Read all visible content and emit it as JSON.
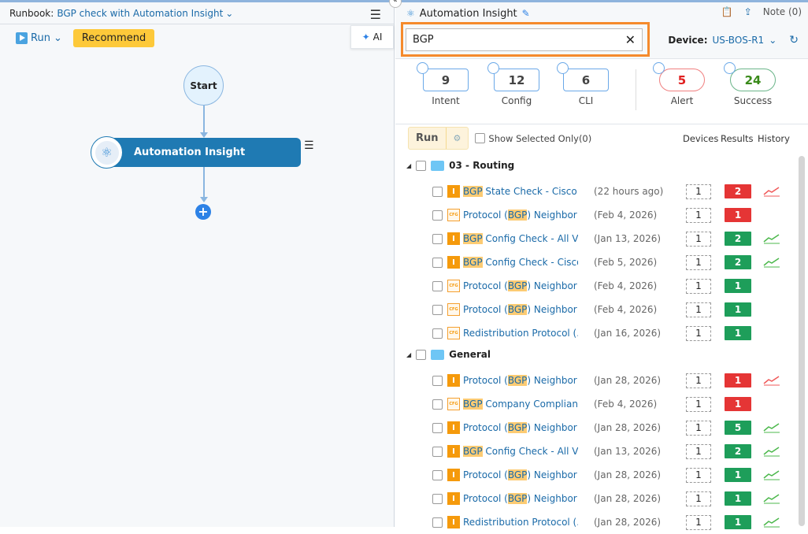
{
  "left": {
    "runbook_label": "Runbook:",
    "runbook_name": "BGP check with Automation Insight",
    "run_label": "Run",
    "recommend_label": "Recommend",
    "ai_label": "AI",
    "start_label": "Start",
    "node_label": "Automation Insight"
  },
  "right": {
    "title": "Automation Insight",
    "note_label": "Note (0)",
    "search_value": "BGP",
    "device_label": "Device:",
    "device_value": "US-BOS-R1",
    "stats": [
      {
        "value": "9",
        "label": "Intent"
      },
      {
        "value": "12",
        "label": "Config"
      },
      {
        "value": "6",
        "label": "CLI"
      },
      {
        "value": "5",
        "label": "Alert"
      },
      {
        "value": "24",
        "label": "Success"
      }
    ],
    "run_label": "Run",
    "show_selected_label": "Show Selected Only(0)",
    "columns": {
      "devices": "Devices",
      "results": "Results",
      "history": "History"
    },
    "colors": {
      "red": "#e53535",
      "green": "#1e9e5a"
    },
    "folders": [
      {
        "name": "03 - Routing",
        "rows": [
          {
            "type": "I",
            "pre": "",
            "hl": "BGP",
            "post": " State Check - Cisco I...",
            "date": "(22 hours ago)",
            "devices": "1",
            "result": "2",
            "status": "red",
            "history": "red"
          },
          {
            "type": "CFG",
            "pre": "Protocol (",
            "hl": "BGP",
            "post": ") Neighbor ...",
            "date": "(Feb 4, 2026)",
            "devices": "1",
            "result": "1",
            "status": "red",
            "history": ""
          },
          {
            "type": "I",
            "pre": "",
            "hl": "BGP",
            "post": " Config Check - All Ve...",
            "date": "(Jan 13, 2026)",
            "devices": "1",
            "result": "2",
            "status": "green",
            "history": "green"
          },
          {
            "type": "I",
            "pre": "",
            "hl": "BGP",
            "post": " Config Check - Cisco...",
            "date": "(Feb 5, 2026)",
            "devices": "1",
            "result": "2",
            "status": "green",
            "history": "green"
          },
          {
            "type": "CFG",
            "pre": "Protocol (",
            "hl": "BGP",
            "post": ") Neighbor ...",
            "date": "(Feb 4, 2026)",
            "devices": "1",
            "result": "1",
            "status": "green",
            "history": ""
          },
          {
            "type": "CFG",
            "pre": "Protocol (",
            "hl": "BGP",
            "post": ") Neighbor ...",
            "date": "(Feb 4, 2026)",
            "devices": "1",
            "result": "1",
            "status": "green",
            "history": ""
          },
          {
            "type": "CFG",
            "pre": "Redistribution Protocol (...",
            "hl": "",
            "post": "",
            "date": "(Jan 16, 2026)",
            "devices": "1",
            "result": "1",
            "status": "green",
            "history": ""
          }
        ]
      },
      {
        "name": "General",
        "rows": [
          {
            "type": "I",
            "pre": "Protocol (",
            "hl": "BGP",
            "post": ") Neighbor ...",
            "date": "(Jan 28, 2026)",
            "devices": "1",
            "result": "1",
            "status": "red",
            "history": "red"
          },
          {
            "type": "CFG",
            "pre": "",
            "hl": "BGP",
            "post": " Company Compliance",
            "date": "(Feb 4, 2026)",
            "devices": "1",
            "result": "1",
            "status": "red",
            "history": ""
          },
          {
            "type": "I",
            "pre": "Protocol (",
            "hl": "BGP",
            "post": ") Neighbor ...",
            "date": "(Jan 28, 2026)",
            "devices": "1",
            "result": "5",
            "status": "green",
            "history": "green"
          },
          {
            "type": "I",
            "pre": "",
            "hl": "BGP",
            "post": " Config Check - All Ve...",
            "date": "(Jan 13, 2026)",
            "devices": "1",
            "result": "2",
            "status": "green",
            "history": "green"
          },
          {
            "type": "I",
            "pre": "Protocol (",
            "hl": "BGP",
            "post": ") Neighbor ...",
            "date": "(Jan 28, 2026)",
            "devices": "1",
            "result": "1",
            "status": "green",
            "history": "green"
          },
          {
            "type": "I",
            "pre": "Protocol (",
            "hl": "BGP",
            "post": ") Neighbor ...",
            "date": "(Jan 28, 2026)",
            "devices": "1",
            "result": "1",
            "status": "green",
            "history": "green"
          },
          {
            "type": "I",
            "pre": "Redistribution Protocol (...",
            "hl": "",
            "post": "",
            "date": "(Jan 28, 2026)",
            "devices": "1",
            "result": "1",
            "status": "green",
            "history": "green"
          }
        ]
      }
    ]
  }
}
